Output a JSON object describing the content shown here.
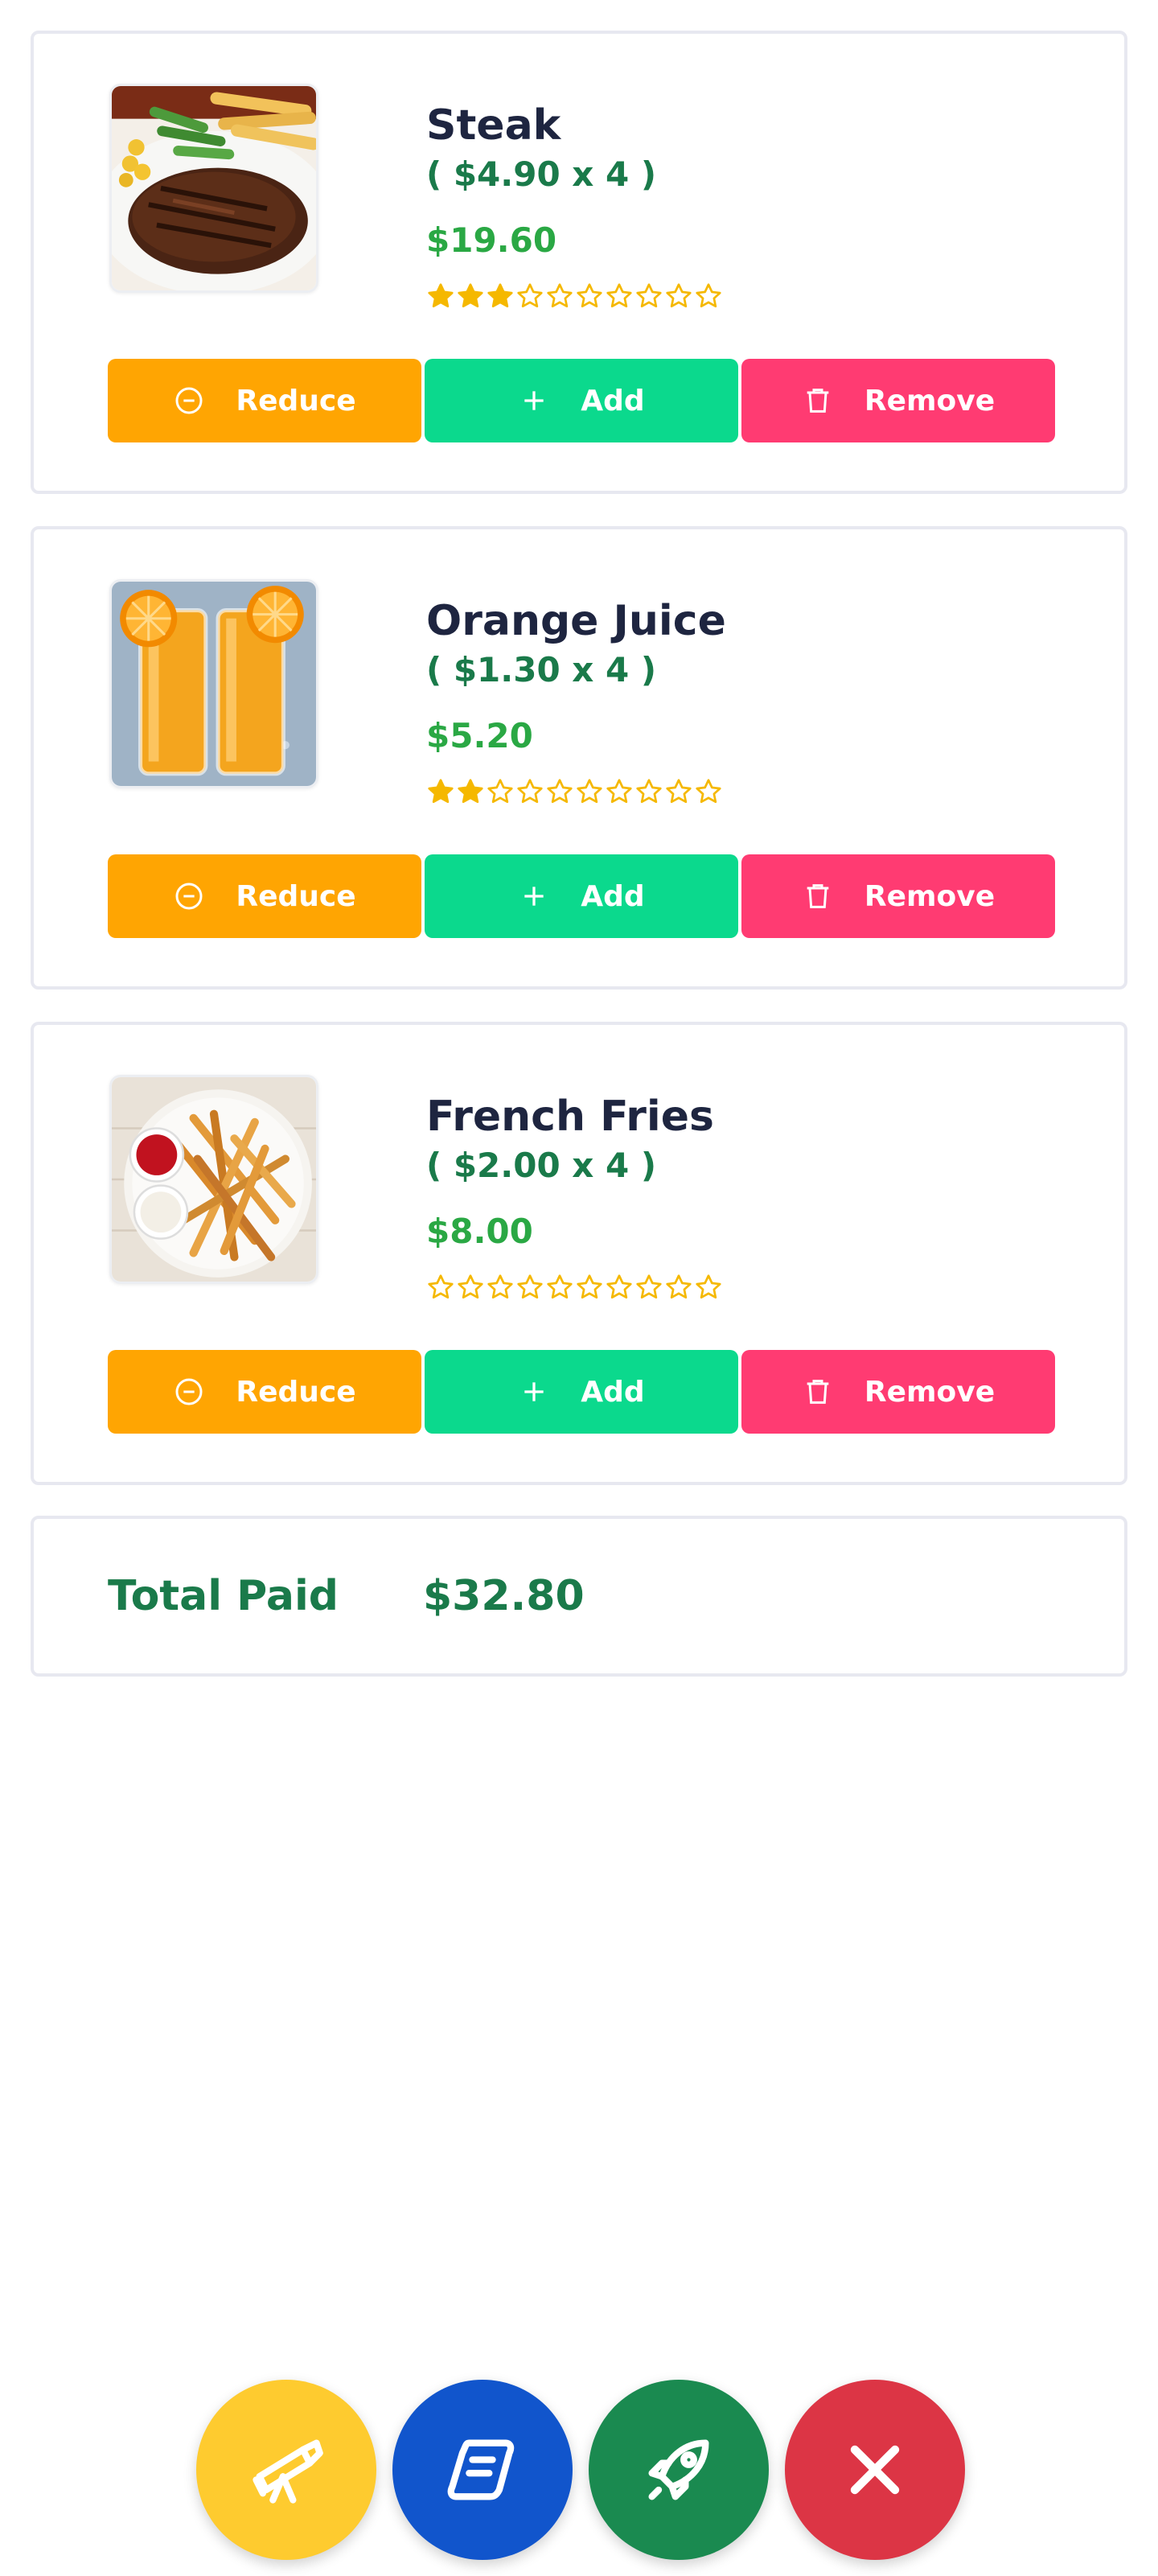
{
  "items": [
    {
      "name": "Steak",
      "qty_text": "( $4.90 x 4 )",
      "subtotal": "$19.60",
      "rating": 3,
      "max_rating": 10,
      "image_icon": "steak-photo"
    },
    {
      "name": "Orange Juice",
      "qty_text": "( $1.30 x 4 )",
      "subtotal": "$5.20",
      "rating": 2,
      "max_rating": 10,
      "image_icon": "orange-juice-photo"
    },
    {
      "name": "French Fries",
      "qty_text": "( $2.00 x 4 )",
      "subtotal": "$8.00",
      "rating": 0,
      "max_rating": 10,
      "image_icon": "french-fries-photo"
    }
  ],
  "buttons": {
    "reduce": "Reduce",
    "add": "Add",
    "remove": "Remove"
  },
  "total": {
    "label": "Total Paid",
    "value": "$32.80"
  },
  "fab_actions": [
    {
      "icon": "telescope-icon",
      "color": "#fecb2f"
    },
    {
      "icon": "scroll-icon",
      "color": "#1155cc"
    },
    {
      "icon": "rocket-icon",
      "color": "#1a8a50"
    },
    {
      "icon": "close-icon",
      "color": "#dc3545"
    }
  ],
  "colors": {
    "reduce": "#ffa502",
    "add": "#0bd98d",
    "remove": "#ff3b72",
    "star": "#f5b800",
    "name": "#1e2540",
    "qty": "#1a7a4a",
    "subtotal": "#2aa844"
  }
}
